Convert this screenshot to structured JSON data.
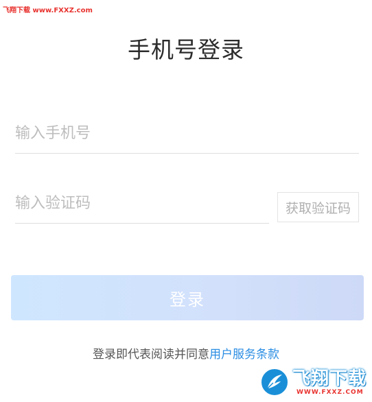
{
  "watermark_top": "飞翔下载 www.FXXZ.com",
  "title": "手机号登录",
  "phone": {
    "placeholder": "输入手机号",
    "value": ""
  },
  "code": {
    "placeholder": "输入验证码",
    "value": ""
  },
  "get_code_label": "获取验证码",
  "login_label": "登录",
  "agreement": {
    "prefix": "登录即代表阅读并同意",
    "link": "用户服务条款"
  },
  "corner_logo": {
    "name": "飞翔下载",
    "url": "WWW.FXXZ.COM"
  },
  "colors": {
    "accent": "#2a8de3",
    "login_button": "#cfe0fb",
    "watermark": "#e8322e"
  }
}
